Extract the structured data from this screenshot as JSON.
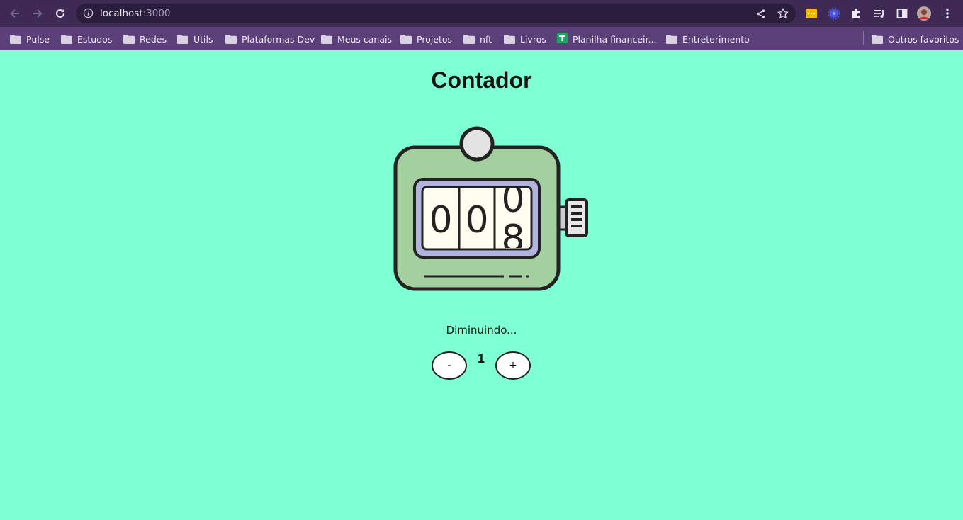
{
  "browser": {
    "url_host": "localhost",
    "url_port": ":3000",
    "nav_icons": [
      "back-arrow-icon",
      "forward-arrow-icon",
      "reload-icon"
    ],
    "bookmarks": [
      {
        "label": "Pulse",
        "icon": "folder-icon"
      },
      {
        "label": "Estudos",
        "icon": "folder-icon"
      },
      {
        "label": "Redes",
        "icon": "folder-icon"
      },
      {
        "label": "Utils",
        "icon": "folder-icon"
      },
      {
        "label": "Plataformas Dev",
        "icon": "folder-icon"
      },
      {
        "label": "Meus canais",
        "icon": "folder-icon"
      },
      {
        "label": "Projetos",
        "icon": "folder-icon"
      },
      {
        "label": "nft",
        "icon": "folder-icon"
      },
      {
        "label": "Livros",
        "icon": "folder-icon"
      },
      {
        "label": "Planilha financeir...",
        "icon": "sheets-icon"
      },
      {
        "label": "Entreterimento",
        "icon": "folder-icon"
      }
    ],
    "other_bookmarks": "Outros favoritos"
  },
  "page": {
    "title": "Contador",
    "digits": [
      "0",
      "0",
      "0",
      "8"
    ],
    "status": "Diminuindo...",
    "step_value": "1",
    "minus_label": "-",
    "plus_label": "+"
  },
  "colors": {
    "page_bg": "#7fffd4",
    "device_body": "#a3d09e",
    "display_frame": "#b3b3e0",
    "digit_window": "#fffdf0",
    "outline": "#222222"
  }
}
